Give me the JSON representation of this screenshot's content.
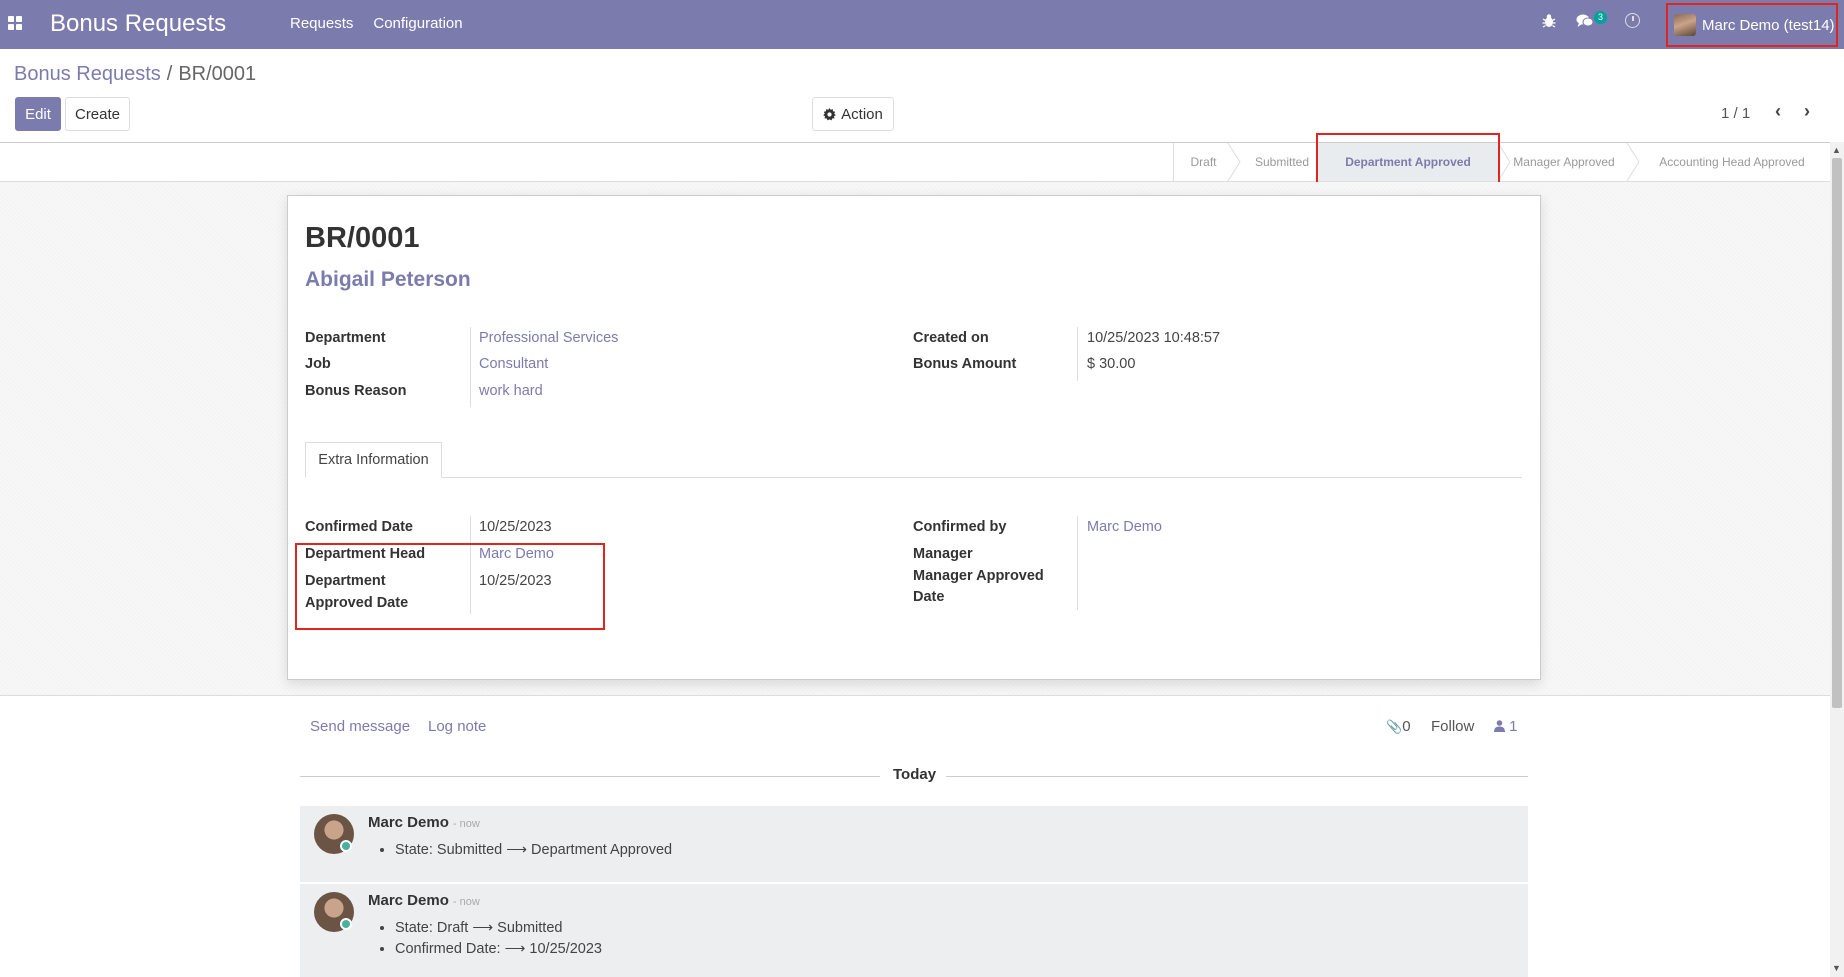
{
  "navbar": {
    "app_title": "Bonus Requests",
    "menu": [
      "Requests",
      "Configuration"
    ],
    "chat_count": "3",
    "user_name": "Marc Demo (test14)"
  },
  "breadcrumb": {
    "parent": "Bonus Requests",
    "sep": "/",
    "current": "BR/0001"
  },
  "buttons": {
    "edit": "Edit",
    "create": "Create",
    "action": "Action"
  },
  "pager": {
    "value": "1 / 1"
  },
  "statusbar": {
    "steps": [
      "Draft",
      "Submitted",
      "Department Approved",
      "Manager Approved",
      "Accounting Head Approved"
    ],
    "active": "Department Approved"
  },
  "record": {
    "name": "BR/0001",
    "employee": "Abigail Peterson",
    "left_fields": [
      {
        "label": "Department",
        "value": "Professional Services"
      },
      {
        "label": "Job",
        "value": "Consultant"
      },
      {
        "label": "Bonus Reason",
        "value": "work hard"
      }
    ],
    "right_fields": [
      {
        "label": "Created on",
        "value": "10/25/2023 10:48:57"
      },
      {
        "label": "Bonus Amount",
        "value": "$ 30.00"
      }
    ]
  },
  "tabs": {
    "extra_info": "Extra Information"
  },
  "extra": {
    "confirmed_date_label": "Confirmed Date",
    "confirmed_date": "10/25/2023",
    "dept_head_label": "Department Head",
    "dept_head": "Marc Demo",
    "dept_approved_label_1": "Department",
    "dept_approved_label_2": "Approved Date",
    "dept_approved_date": "10/25/2023",
    "confirmed_by_label": "Confirmed by",
    "confirmed_by": "Marc Demo",
    "manager_label": "Manager",
    "manager_approved_label_1": "Manager Approved",
    "manager_approved_label_2": "Date"
  },
  "chatter": {
    "send_message": "Send message",
    "log_note": "Log note",
    "attachments": "0",
    "follow": "Follow",
    "followers": "1",
    "today": "Today",
    "messages": [
      {
        "author": "Marc Demo",
        "date": "- now",
        "lines": [
          "State: Submitted ⟶ Department Approved"
        ]
      },
      {
        "author": "Marc Demo",
        "date": "- now",
        "lines": [
          "State: Draft ⟶ Submitted",
          "Confirmed Date: ⟶ 10/25/2023"
        ]
      }
    ]
  },
  "colors": {
    "brand": "#7c7bad",
    "highlight": "#e0251f"
  }
}
